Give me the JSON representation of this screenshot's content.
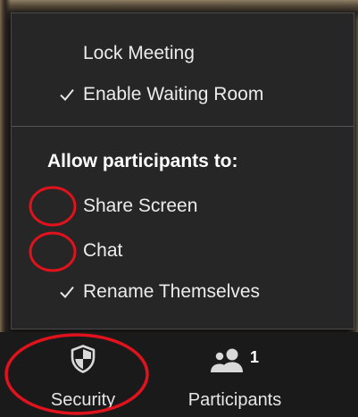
{
  "menu": {
    "lock_meeting": "Lock Meeting",
    "enable_waiting_room": "Enable Waiting Room",
    "enable_waiting_room_checked": true,
    "allow_heading": "Allow participants to:",
    "share_screen": "Share Screen",
    "share_screen_checked": false,
    "chat": "Chat",
    "chat_checked": false,
    "rename_themselves": "Rename Themselves",
    "rename_themselves_checked": true
  },
  "toolbar": {
    "security_label": "Security",
    "security_icon": "shield-icon",
    "participants_label": "Participants",
    "participants_icon": "people-icon",
    "participants_count": "1"
  },
  "annotations": {
    "color": "#e0121c"
  }
}
